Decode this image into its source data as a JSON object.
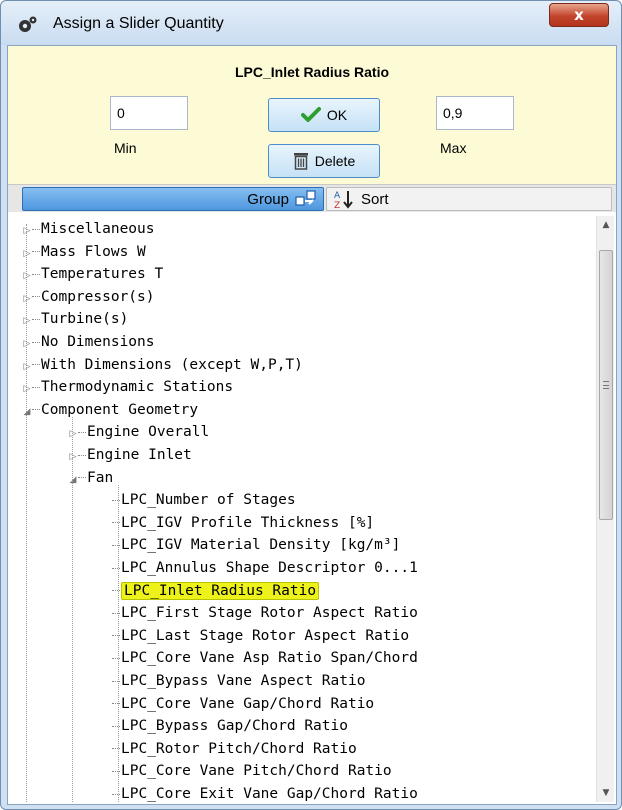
{
  "window": {
    "title": "Assign a Slider Quantity",
    "close_label": "x"
  },
  "quantity": {
    "name": "LPC_Inlet Radius Ratio",
    "min_value": "0",
    "max_value": "0,9",
    "min_label": "Min",
    "max_label": "Max"
  },
  "buttons": {
    "ok_label": "OK",
    "delete_label": "Delete"
  },
  "toolbar": {
    "group_label": "Group",
    "sort_label": "Sort"
  },
  "tree": {
    "top_level": [
      {
        "label": "Miscellaneous",
        "expanded": false
      },
      {
        "label": "Mass Flows W",
        "expanded": false
      },
      {
        "label": "Temperatures T",
        "expanded": false
      },
      {
        "label": "Compressor(s)",
        "expanded": false
      },
      {
        "label": "Turbine(s)",
        "expanded": false
      },
      {
        "label": "No Dimensions",
        "expanded": false
      },
      {
        "label": "With Dimensions (except W,P,T)",
        "expanded": false
      },
      {
        "label": "Thermodynamic Stations",
        "expanded": false
      },
      {
        "label": "Component Geometry",
        "expanded": true
      }
    ],
    "geometry_children": [
      {
        "label": "Engine Overall",
        "expanded": false
      },
      {
        "label": "Engine Inlet",
        "expanded": false
      },
      {
        "label": "Fan",
        "expanded": true
      }
    ],
    "fan_items": [
      "LPC_Number of Stages",
      "LPC_IGV Profile Thickness [%]",
      "LPC_IGV Material Density [kg/m³]",
      "LPC_Annulus Shape Descriptor 0...1",
      "LPC_Inlet Radius Ratio",
      "LPC_First Stage Rotor Aspect Ratio",
      "LPC_Last Stage Rotor Aspect Ratio",
      "LPC_Core Vane Asp Ratio Span/Chord",
      "LPC_Bypass Vane Aspect Ratio",
      "LPC_Core Vane Gap/Chord Ratio",
      "LPC_Bypass Gap/Chord Ratio",
      "LPC_Rotor Pitch/Chord Ratio",
      "LPC_Core Vane Pitch/Chord Ratio",
      "LPC_Core Exit Vane Gap/Chord Ratio"
    ],
    "selected_item": "LPC_Inlet Radius Ratio"
  },
  "colors": {
    "panel_bg": "#fdfbd6",
    "selection": "#ecf21a",
    "group_button": "#4d97df",
    "ok_check": "#2e9e2e"
  }
}
